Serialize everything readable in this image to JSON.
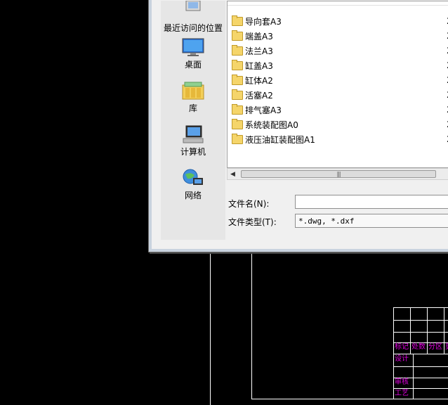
{
  "places": [
    {
      "label": "最近访问的位置",
      "icon": "recent-places-icon"
    },
    {
      "label": "桌面",
      "icon": "desktop-icon"
    },
    {
      "label": "库",
      "icon": "library-icon"
    },
    {
      "label": "计算机",
      "icon": "computer-icon"
    },
    {
      "label": "网络",
      "icon": "network-icon"
    }
  ],
  "files": [
    {
      "name": "导向套A3",
      "icon": "folder-icon",
      "date_prefix": "2"
    },
    {
      "name": "端盖A3",
      "icon": "folder-icon",
      "date_prefix": "2"
    },
    {
      "name": "法兰A3",
      "icon": "folder-icon",
      "date_prefix": "2"
    },
    {
      "name": "缸盖A3",
      "icon": "folder-icon",
      "date_prefix": "2"
    },
    {
      "name": "缸体A2",
      "icon": "folder-icon",
      "date_prefix": "2"
    },
    {
      "name": "活塞A2",
      "icon": "folder-icon",
      "date_prefix": "2"
    },
    {
      "name": "排气塞A3",
      "icon": "folder-icon",
      "date_prefix": "2"
    },
    {
      "name": "系统装配图A0",
      "icon": "folder-icon",
      "date_prefix": "2"
    },
    {
      "name": "液压油缸装配图A1",
      "icon": "folder-icon",
      "date_prefix": "2"
    }
  ],
  "filename_label": "文件名(N):",
  "filename_value": "",
  "filetype_label": "文件类型(T):",
  "filetype_value": "*.dwg, *.dxf",
  "title_block": {
    "row1": [
      "标记",
      "处数",
      "分区",
      "更"
    ],
    "design": "设计",
    "review": "审核",
    "process": "工艺"
  },
  "colors": {
    "cad_text": "#e000e0",
    "background": "#000000"
  }
}
